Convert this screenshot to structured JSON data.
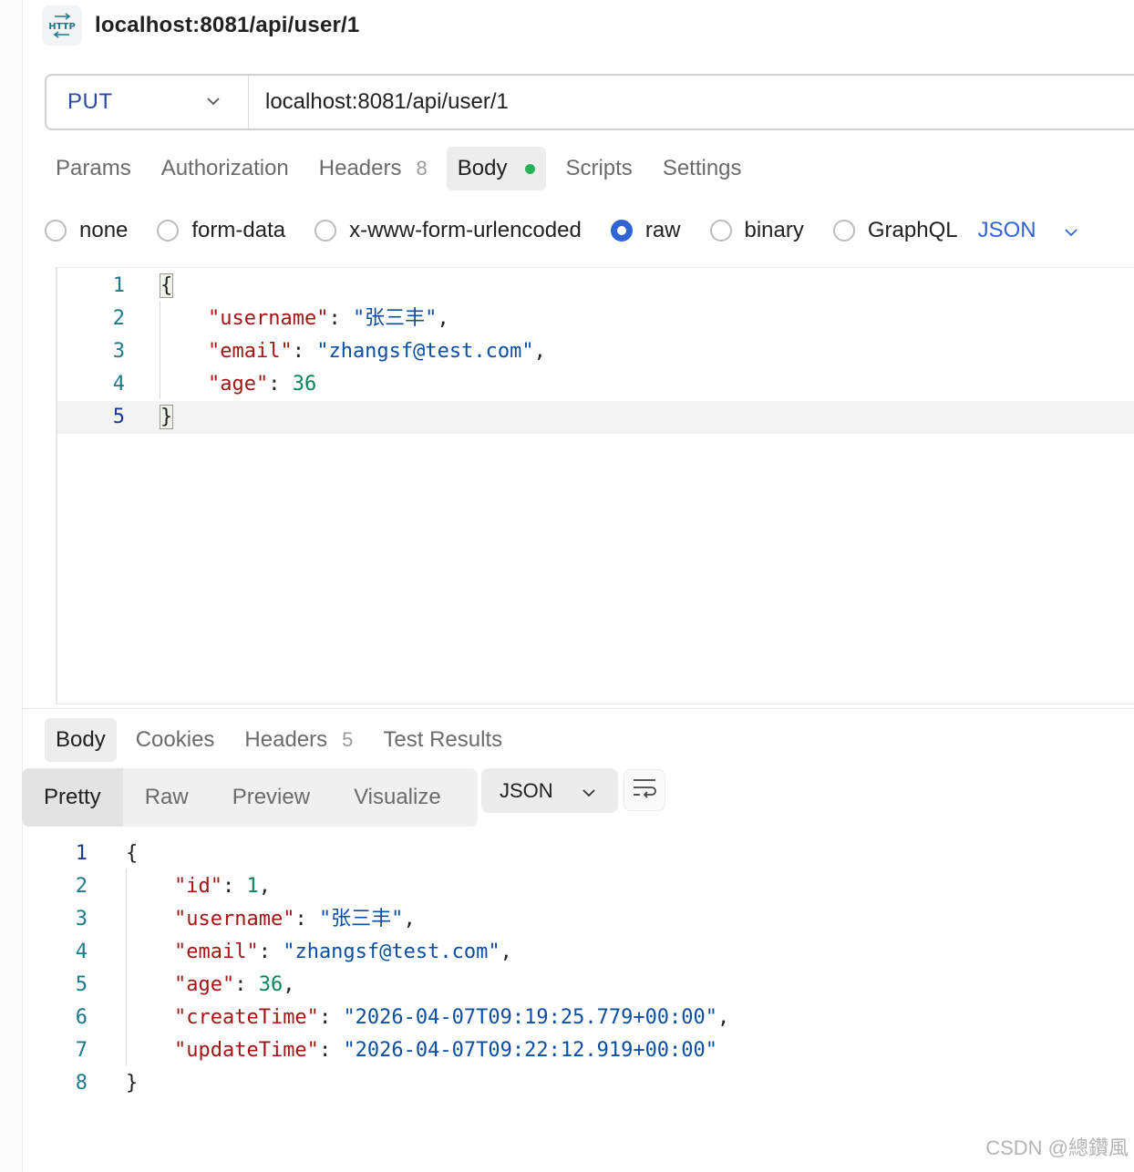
{
  "header": {
    "title": "localhost:8081/api/user/1",
    "icon": "http-icon"
  },
  "request": {
    "method": "PUT",
    "url": "localhost:8081/api/user/1",
    "tabs": [
      {
        "label": "Params"
      },
      {
        "label": "Authorization"
      },
      {
        "label": "Headers",
        "count": "8"
      },
      {
        "label": "Body",
        "active": true
      },
      {
        "label": "Scripts"
      },
      {
        "label": "Settings"
      }
    ],
    "body_types": [
      "none",
      "form-data",
      "x-www-form-urlencoded",
      "raw",
      "binary",
      "GraphQL"
    ],
    "selected_body_type": "raw",
    "format": "JSON",
    "body_lines": [
      {
        "num": "1",
        "parts": [
          [
            "p",
            "{"
          ]
        ]
      },
      {
        "num": "2",
        "parts": [
          [
            "k",
            "\"username\""
          ],
          [
            "p",
            ": "
          ],
          [
            "s",
            "\"张三丰\""
          ],
          [
            "p",
            ","
          ]
        ]
      },
      {
        "num": "3",
        "parts": [
          [
            "k",
            "\"email\""
          ],
          [
            "p",
            ": "
          ],
          [
            "s",
            "\"zhangsf@test.com\""
          ],
          [
            "p",
            ","
          ]
        ]
      },
      {
        "num": "4",
        "parts": [
          [
            "k",
            "\"age\""
          ],
          [
            "p",
            ": "
          ],
          [
            "n",
            "36"
          ]
        ]
      },
      {
        "num": "5",
        "parts": [
          [
            "p",
            "}"
          ]
        ]
      }
    ]
  },
  "response": {
    "tabs": [
      {
        "label": "Body",
        "active": true
      },
      {
        "label": "Cookies"
      },
      {
        "label": "Headers",
        "count": "5"
      },
      {
        "label": "Test Results"
      }
    ],
    "view_modes": [
      "Pretty",
      "Raw",
      "Preview",
      "Visualize"
    ],
    "active_view": "Pretty",
    "format": "JSON",
    "body_lines": [
      {
        "num": "1",
        "parts": [
          [
            "p",
            "{"
          ]
        ]
      },
      {
        "num": "2",
        "parts": [
          [
            "k",
            "\"id\""
          ],
          [
            "p",
            ": "
          ],
          [
            "n",
            "1"
          ],
          [
            "p",
            ","
          ]
        ]
      },
      {
        "num": "3",
        "parts": [
          [
            "k",
            "\"username\""
          ],
          [
            "p",
            ": "
          ],
          [
            "s",
            "\"张三丰\""
          ],
          [
            "p",
            ","
          ]
        ]
      },
      {
        "num": "4",
        "parts": [
          [
            "k",
            "\"email\""
          ],
          [
            "p",
            ": "
          ],
          [
            "s",
            "\"zhangsf@test.com\""
          ],
          [
            "p",
            ","
          ]
        ]
      },
      {
        "num": "5",
        "parts": [
          [
            "k",
            "\"age\""
          ],
          [
            "p",
            ": "
          ],
          [
            "n",
            "36"
          ],
          [
            "p",
            ","
          ]
        ]
      },
      {
        "num": "6",
        "parts": [
          [
            "k",
            "\"createTime\""
          ],
          [
            "p",
            ": "
          ],
          [
            "s",
            "\"2026-04-07T09:19:25.779+00:00\""
          ],
          [
            "p",
            ","
          ]
        ]
      },
      {
        "num": "7",
        "parts": [
          [
            "k",
            "\"updateTime\""
          ],
          [
            "p",
            ": "
          ],
          [
            "s",
            "\"2026-04-07T09:22:12.919+00:00\""
          ]
        ]
      },
      {
        "num": "8",
        "parts": [
          [
            "p",
            "}"
          ]
        ]
      }
    ]
  },
  "watermark": "CSDN @總鑽風",
  "colors": {
    "accent": "#2f64d7",
    "status_dot": "#27b159",
    "json_key": "#a31515",
    "json_string": "#0b4ea2",
    "json_number": "#098658"
  }
}
